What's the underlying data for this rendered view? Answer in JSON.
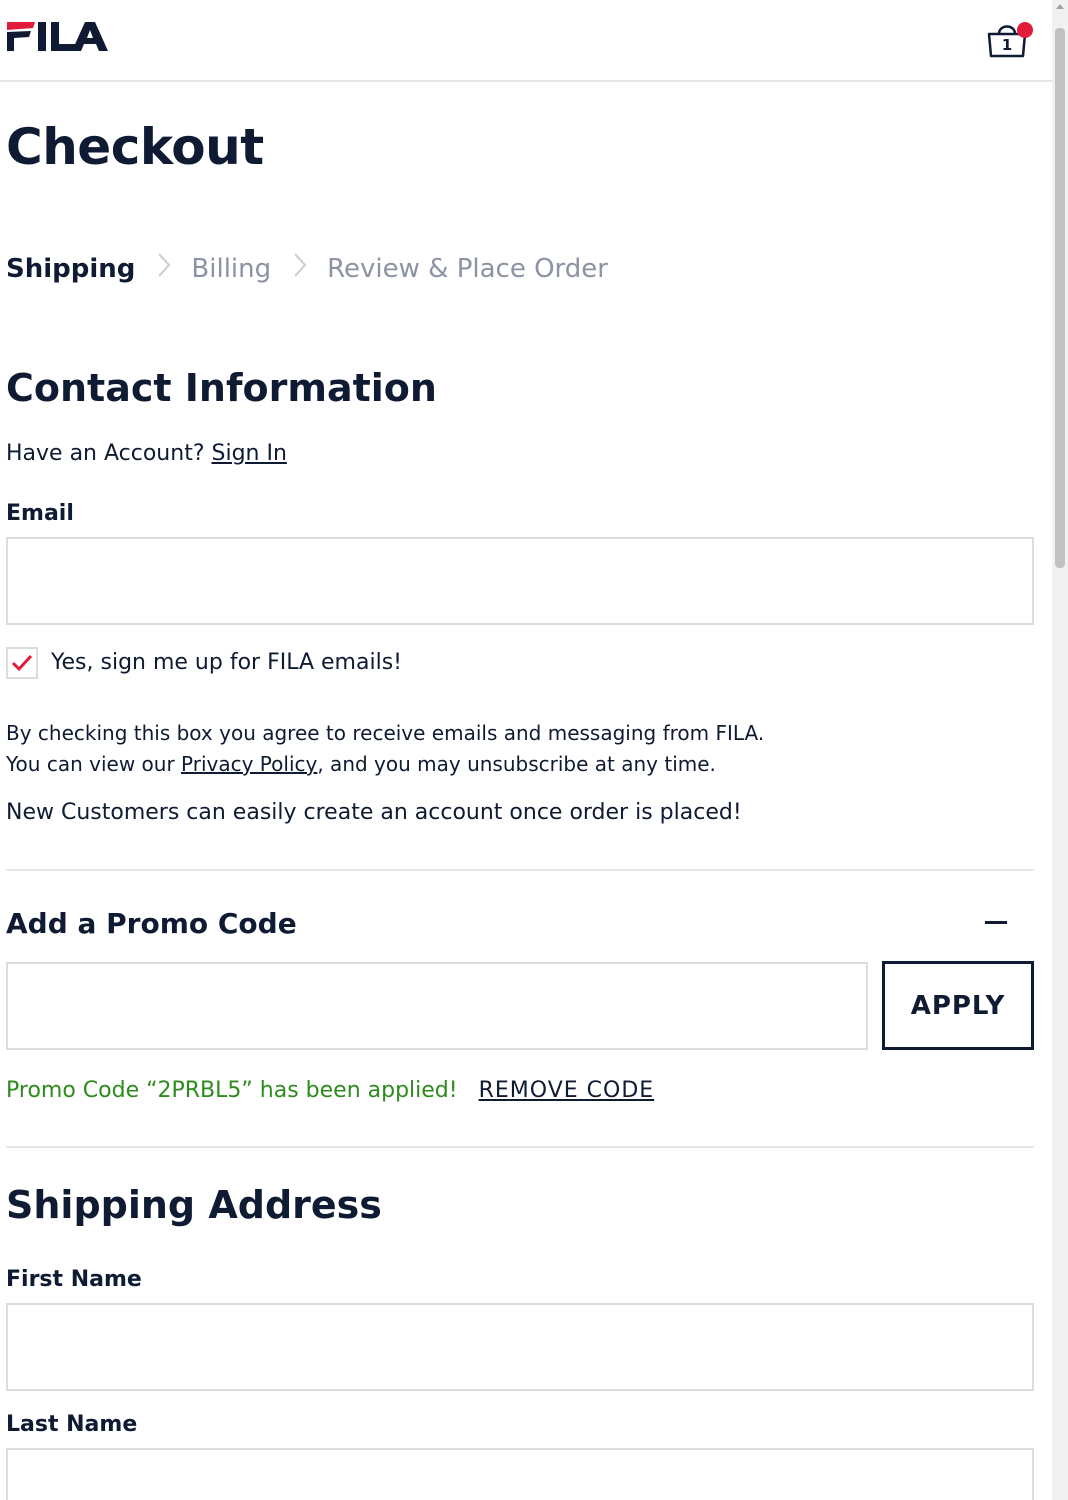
{
  "header": {
    "logo_text": "FILA",
    "cart_count": "1",
    "colors": {
      "brand_red": "#e31b3b",
      "brand_navy": "#0f1b33"
    }
  },
  "page": {
    "title": "Checkout"
  },
  "steps": [
    {
      "label": "Shipping",
      "active": true
    },
    {
      "label": "Billing",
      "active": false
    },
    {
      "label": "Review & Place Order",
      "active": false
    }
  ],
  "contact": {
    "title": "Contact Information",
    "account_prompt": "Have an Account?",
    "sign_in_link": "Sign In",
    "email_label": "Email",
    "email_value": "",
    "signup_label": "Yes, sign me up for FILA emails!",
    "signup_checked": true,
    "disclaimer_part1": "By checking this box you agree to receive emails and messaging from FILA. You can view our",
    "privacy_link": "Privacy Policy",
    "disclaimer_part2": ", and you may unsubscribe at any time.",
    "new_customer_note": "New Customers can easily create an account once order is placed!"
  },
  "promo": {
    "title": "Add a Promo Code",
    "code_value": "",
    "apply_label": "APPLY",
    "applied_message": "Promo Code “2PRBL5” has been applied!",
    "remove_label": "REMOVE CODE"
  },
  "shipping": {
    "title": "Shipping Address",
    "first_name_label": "First Name",
    "first_name_value": "",
    "last_name_label": "Last Name",
    "last_name_value": ""
  }
}
